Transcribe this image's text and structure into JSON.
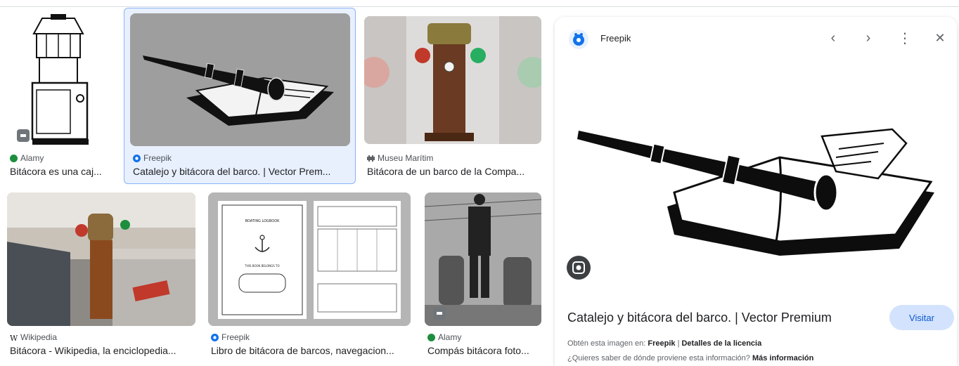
{
  "results": [
    {
      "source": "Alamy",
      "caption": "Bitácora es una caj...",
      "favicon": "alamy-favicon"
    },
    {
      "source": "Freepik",
      "caption": "Catalejo y bitácora del barco. | Vector Prem...",
      "favicon": "freepik-favicon"
    },
    {
      "source": "Museu Marítim",
      "caption": "Bitácora de un barco de la Compa...",
      "favicon": "museu-favicon"
    },
    {
      "source": "Wikipedia",
      "caption": "Bitácora - Wikipedia, la enciclopedia...",
      "favicon": "wikipedia-favicon"
    },
    {
      "source": "Freepik",
      "caption": "Libro de bitácora de barcos, navegacion...",
      "favicon": "freepik-favicon"
    },
    {
      "source": "Alamy",
      "caption": "Compás bitácora foto...",
      "favicon": "alamy-favicon"
    }
  ],
  "logbook": {
    "cover_title": "BOATING LOGBOOK",
    "cover_subtitle": "THIS BOOK BELONGS TO"
  },
  "preview": {
    "source": "Freepik",
    "title": "Catalejo y bitácora del barco. | Vector Premium",
    "visit_label": "Visitar",
    "get_image_prefix": "Obtén esta imagen en:",
    "get_image_source": "Freepik",
    "separator": "|",
    "license_label": "Detalles de la licencia",
    "where_from_question": "¿Quieres saber de dónde proviene esta información?",
    "more_info_label": "Más información",
    "controls": {
      "prev": "‹",
      "next": "›",
      "more": "⋮",
      "close": "✕"
    }
  },
  "colors": {
    "selected_bg": "#e8f0fe",
    "selected_border": "#8ab4f8",
    "visit_bg": "#d3e3fd",
    "freepik_blue": "#1273eb",
    "alamy_green": "#1e8e3e"
  }
}
